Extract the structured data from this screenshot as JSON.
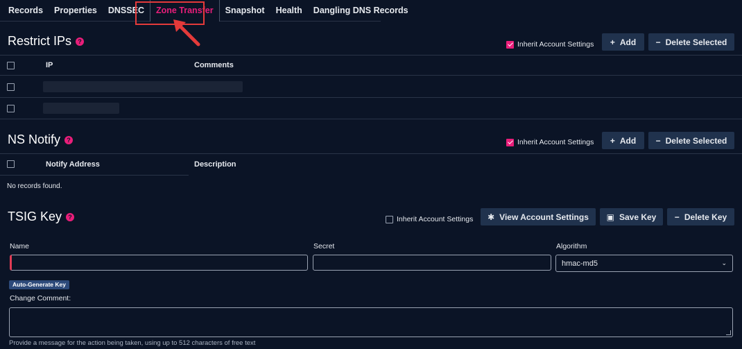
{
  "tabs": [
    {
      "label": "Records",
      "active": false
    },
    {
      "label": "Properties",
      "active": false
    },
    {
      "label": "DNSSEC",
      "active": false
    },
    {
      "label": "Zone Transfer",
      "active": true
    },
    {
      "label": "Snapshot",
      "active": false
    },
    {
      "label": "Health",
      "active": false
    },
    {
      "label": "Dangling DNS Records",
      "active": false
    }
  ],
  "restrict_ips": {
    "title": "Restrict IPs",
    "inherit_label": "Inherit Account Settings",
    "inherit_checked": true,
    "add_label": "Add",
    "delete_label": "Delete Selected",
    "columns": [
      "IP",
      "Comments"
    ]
  },
  "ns_notify": {
    "title": "NS Notify",
    "inherit_label": "Inherit Account Settings",
    "inherit_checked": true,
    "add_label": "Add",
    "delete_label": "Delete Selected",
    "columns": [
      "Notify Address",
      "Description"
    ],
    "empty_text": "No records found."
  },
  "tsig": {
    "title": "TSIG Key",
    "inherit_label": "Inherit Account Settings",
    "inherit_checked": false,
    "view_label": "View Account Settings",
    "save_label": "Save Key",
    "delete_label": "Delete Key",
    "name_label": "Name",
    "secret_label": "Secret",
    "algorithm_label": "Algorithm",
    "algorithm_value": "hmac-md5",
    "autogen_label": "Auto-Generate Key",
    "comment_label": "Change Comment:",
    "hint": "Provide a message for the action being taken, using up to 512 characters of free text"
  },
  "colors": {
    "accent": "#e91e7a",
    "background": "#0b1426",
    "button": "#20324d",
    "highlight": "#e43a3a"
  }
}
